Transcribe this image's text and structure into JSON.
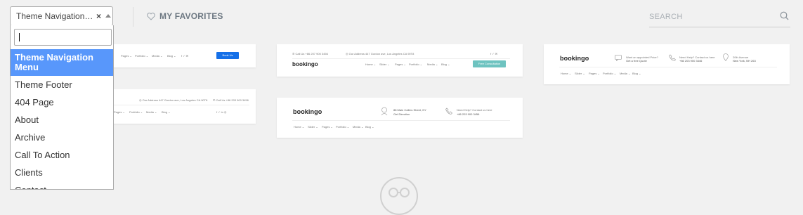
{
  "filter": {
    "selected": "Theme Navigation M…",
    "clear_glyph": "×",
    "options": [
      "Theme Navigation Menu",
      "Theme Footer",
      "404 Page",
      "About",
      "Archive",
      "Call To Action",
      "Clients",
      "Contact"
    ]
  },
  "favorites": {
    "label": "MY FAVORITES"
  },
  "search": {
    "placeholder": "SEARCH"
  },
  "cards": {
    "c1": {
      "nav": [
        "Pages ⌄",
        "Portfolio ⌄",
        "Media ⌄",
        "Blog ⌄"
      ],
      "social": "f  ✓  ✉",
      "button": "Book Us"
    },
    "c2": {
      "address": "◎ Our Address 447 Gordon ave, Los Angeles CA 90T8",
      "phone": "✆ Call Us +86 203 900 3456",
      "nav": [
        "Pages ⌄",
        "Portfolio ⌄",
        "Media ⌄",
        "Blog ⌄"
      ],
      "social": "f  ✓  in  ◎"
    },
    "c3": {
      "phone": "✆ Call Us +86 207 900 3456",
      "address": "◎ Our Address 447 Gordon ave, Los Angeles CA 90T8",
      "social": "f  ✓  ✉",
      "logo": "bookingo",
      "nav": [
        "Home ⌄",
        "Slider ⌄",
        "Pages ⌄",
        "Portfolio ⌄",
        "Media ⌄",
        "Blog ⌄"
      ],
      "button": "Free Consultation"
    },
    "c4": {
      "logo": "bookingo",
      "addr1": "88 Main Collins Street, NY",
      "addr2": "Get Direction",
      "help1": "Need Help? Contact us here",
      "help2": "+86 203 900 3456",
      "nav": [
        "Home ⌄",
        "Slider ⌄",
        "Pages ⌄",
        "Portfolio ⌄",
        "Media ⌄",
        "Blog ⌄"
      ]
    },
    "c5": {
      "logo": "bookingo",
      "appt1": "Want an appointed Price?",
      "appt2": "Get a free Quote",
      "help1": "Need Help? Contact us here",
      "help2": "+86 203 900 3446",
      "loc1": "20th Avenue",
      "loc2": "New York, NH 263",
      "nav": [
        "Home ⌄",
        "Slider ⌄",
        "Pages ⌄",
        "Portfolio ⌄",
        "Media ⌄",
        "Blog ⌄"
      ]
    }
  },
  "icons": {
    "favorites": "heart-icon",
    "search": "search-icon",
    "bottom": "library-logo-icon"
  }
}
